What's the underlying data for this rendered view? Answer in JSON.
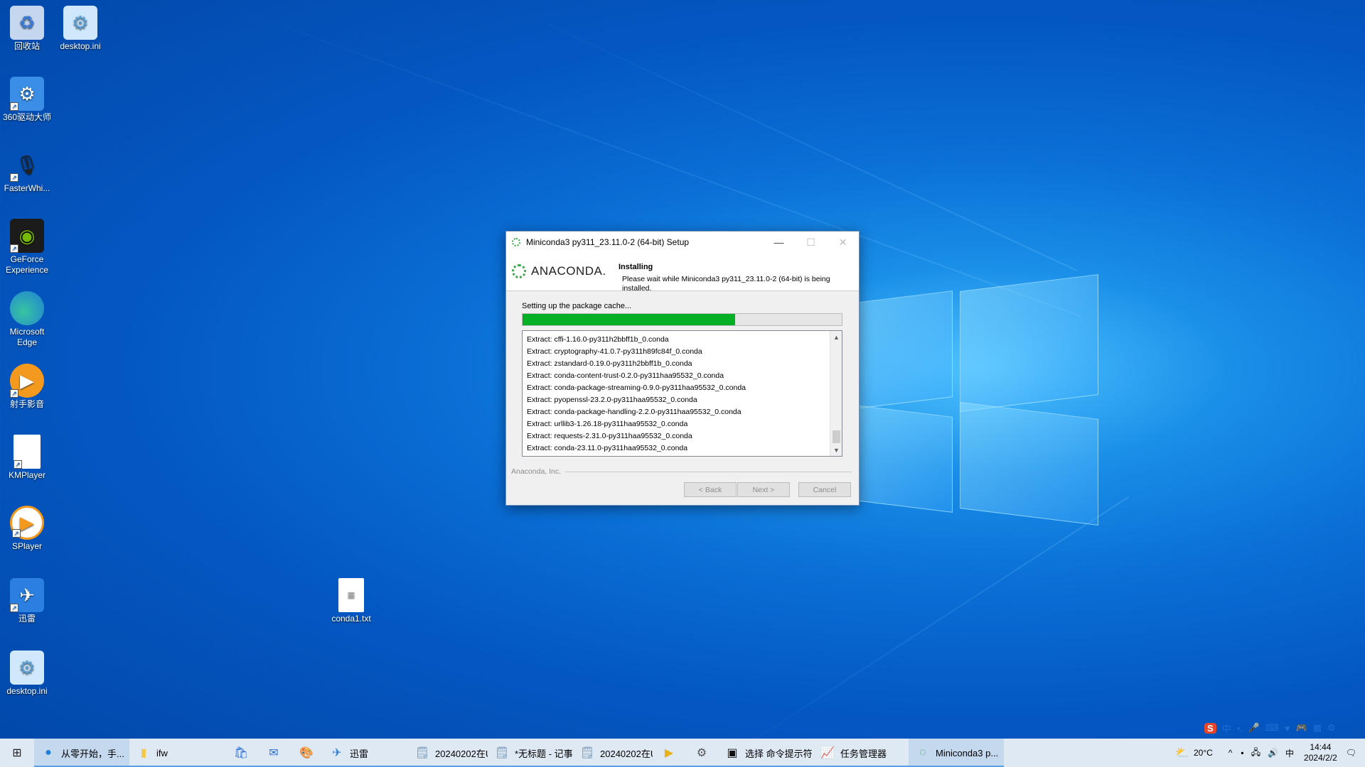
{
  "desktop": {
    "icons": [
      {
        "label": "回收站"
      },
      {
        "label": "desktop.ini"
      },
      {
        "label": "360驱动大师"
      },
      {
        "label": "FasterWhi..."
      },
      {
        "label": "GeForce Experience"
      },
      {
        "label": "Microsoft Edge"
      },
      {
        "label": "射手影音"
      },
      {
        "label": "KMPlayer"
      },
      {
        "label": "SPlayer"
      },
      {
        "label": "迅雷"
      },
      {
        "label": "desktop.ini"
      },
      {
        "label": "conda1.txt"
      }
    ]
  },
  "installer": {
    "title": "Miniconda3 py311_23.11.0-2 (64-bit) Setup",
    "logo_text": "ANACONDA.",
    "header_title": "Installing",
    "header_subtitle": "Please wait while Miniconda3 py311_23.11.0-2 (64-bit) is being installed.",
    "status_text": "Setting up the package cache...",
    "progress_fraction": 0.665,
    "log_lines": [
      "Extract: cffi-1.16.0-py311h2bbff1b_0.conda",
      "Extract: cryptography-41.0.7-py311h89fc84f_0.conda",
      "Extract: zstandard-0.19.0-py311h2bbff1b_0.conda",
      "Extract: conda-content-trust-0.2.0-py311haa95532_0.conda",
      "Extract: conda-package-streaming-0.9.0-py311haa95532_0.conda",
      "Extract: pyopenssl-23.2.0-py311haa95532_0.conda",
      "Extract: conda-package-handling-2.2.0-py311haa95532_0.conda",
      "Extract: urllib3-1.26.18-py311haa95532_0.conda",
      "Extract: requests-2.31.0-py311haa95532_0.conda",
      "Extract: conda-23.11.0-py311haa95532_0.conda"
    ],
    "brand_footer": "Anaconda, Inc.",
    "back_label": "< Back",
    "next_label": "Next >",
    "cancel_label": "Cancel",
    "accent_color": "#06b025"
  },
  "taskbar": {
    "items": [
      {
        "label": "从零开始，手...",
        "icon": "edge-icon"
      },
      {
        "label": "ifw",
        "icon": "folder-icon"
      },
      {
        "label": "",
        "icon": "store-icon"
      },
      {
        "label": "",
        "icon": "mail-icon"
      },
      {
        "label": "",
        "icon": "paint-icon"
      },
      {
        "label": "迅雷",
        "icon": "thunder-icon"
      },
      {
        "label": "20240202在U...",
        "icon": "notepad-icon"
      },
      {
        "label": "*无标题 - 记事本",
        "icon": "notepad-icon"
      },
      {
        "label": "20240202在U...",
        "icon": "notepad-icon"
      },
      {
        "label": "",
        "icon": "player-icon"
      },
      {
        "label": "",
        "icon": "settings-icon"
      },
      {
        "label": "选择 命令提示符",
        "icon": "cmd-icon"
      },
      {
        "label": "任务管理器",
        "icon": "taskmgr-icon"
      },
      {
        "label": "Miniconda3 p...",
        "icon": "conda-icon"
      }
    ],
    "weather": "20°C",
    "time": "14:44",
    "date": "2024/2/2",
    "ime_lang": "中"
  }
}
